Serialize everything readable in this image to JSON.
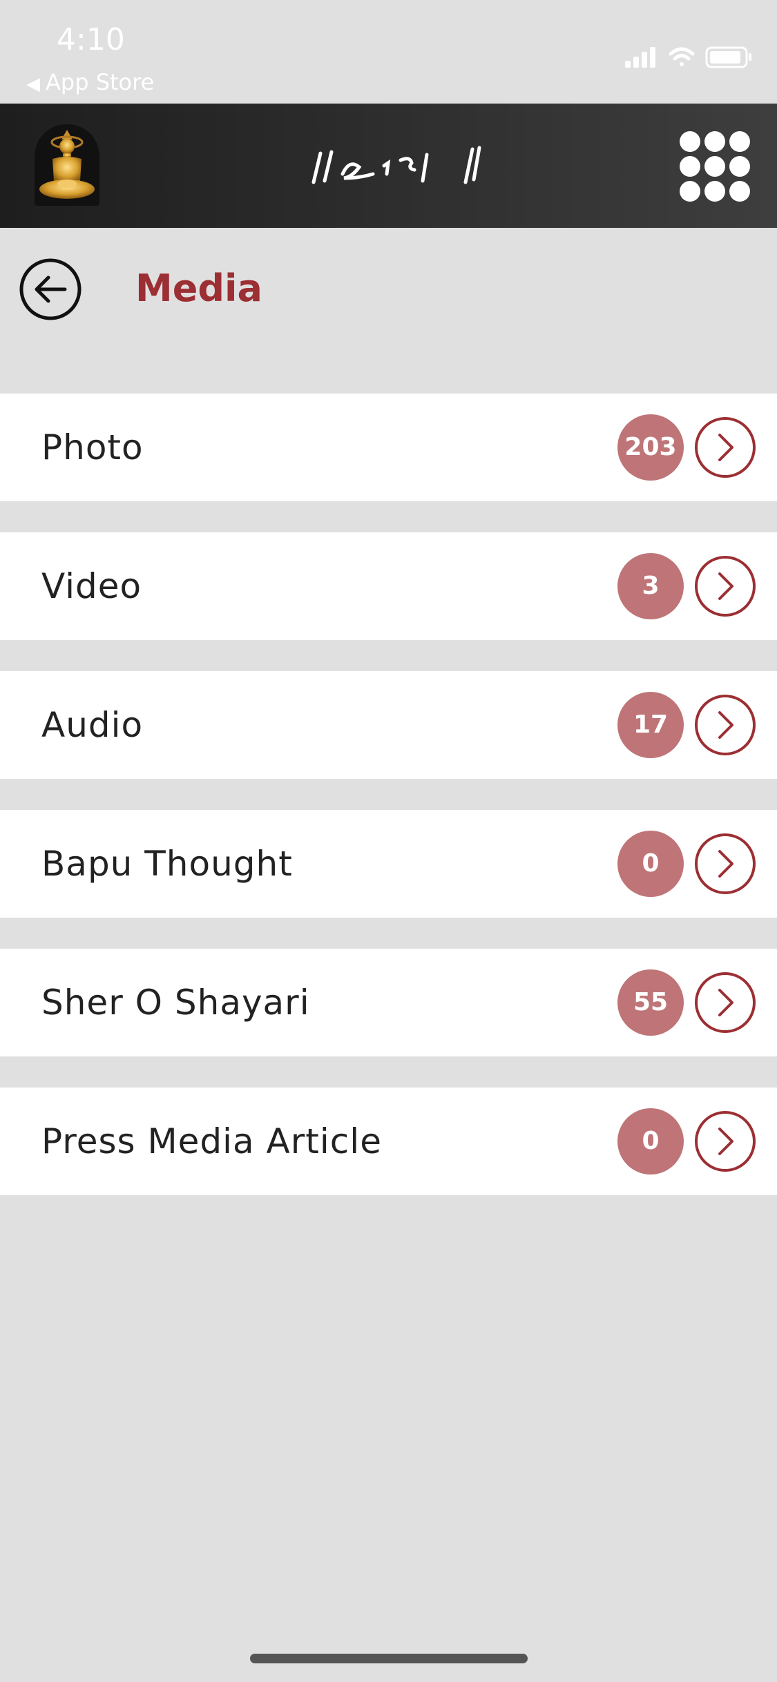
{
  "status_bar": {
    "time": "4:10",
    "back_label": "App Store",
    "icons": [
      "cellular-signal-icon",
      "wifi-icon",
      "battery-icon"
    ]
  },
  "header": {
    "logo": "deity-logo-icon",
    "signature": "signature-logo",
    "menu_icon": "grid-menu-icon"
  },
  "page": {
    "back_icon": "back-arrow-icon",
    "title": "Media"
  },
  "media_items": [
    {
      "label": "Photo",
      "count": "203"
    },
    {
      "label": "Video",
      "count": "3"
    },
    {
      "label": "Audio",
      "count": "17"
    },
    {
      "label": "Bapu Thought",
      "count": "0"
    },
    {
      "label": "Sher O Shayari",
      "count": "55"
    },
    {
      "label": "Press Media Article",
      "count": "0"
    }
  ],
  "colors": {
    "accent": "#9c2f33",
    "badge": "#bf7578",
    "background": "#e0e0e0",
    "header": "#2c2c2c"
  }
}
